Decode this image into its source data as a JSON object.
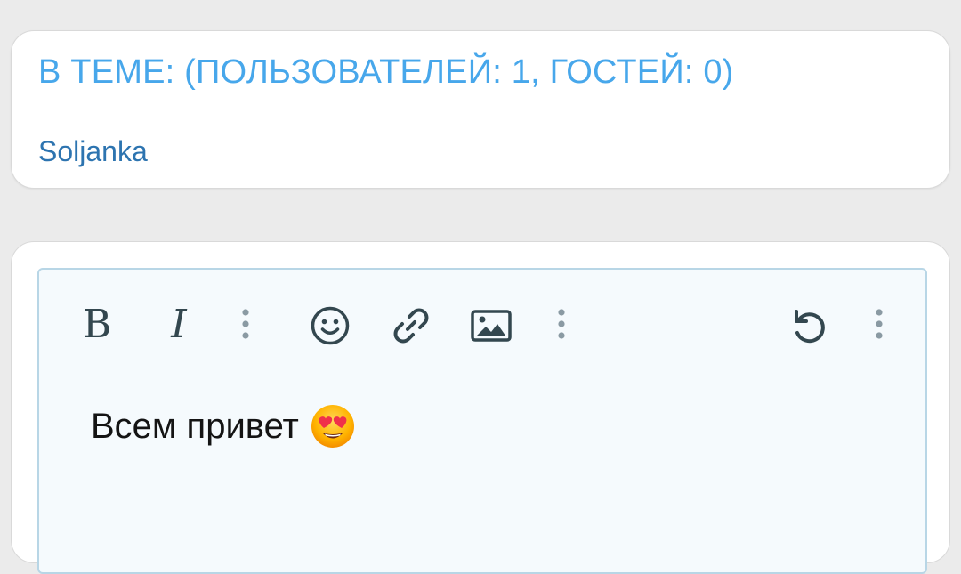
{
  "online": {
    "title": "В ТЕМЕ: (ПОЛЬЗОВАТЕЛЕЙ: 1, ГОСТЕЙ: 0)",
    "users": [
      "Soljanka"
    ]
  },
  "editor": {
    "toolbar": {
      "bold_label": "B",
      "italic_label": "I",
      "icons": [
        "more-vertical-icon",
        "smile-icon",
        "link-icon",
        "image-icon",
        "more-vertical-icon",
        "undo-icon",
        "more-vertical-icon"
      ]
    },
    "content": {
      "text": "Всем привет",
      "emoji": "heart-eyes-emoji"
    }
  },
  "colors": {
    "accent": "#47a7eb",
    "username": "#2d74b0",
    "icon": "#33474f",
    "editor_border": "#b8d6e6",
    "background": "#ebebeb"
  }
}
